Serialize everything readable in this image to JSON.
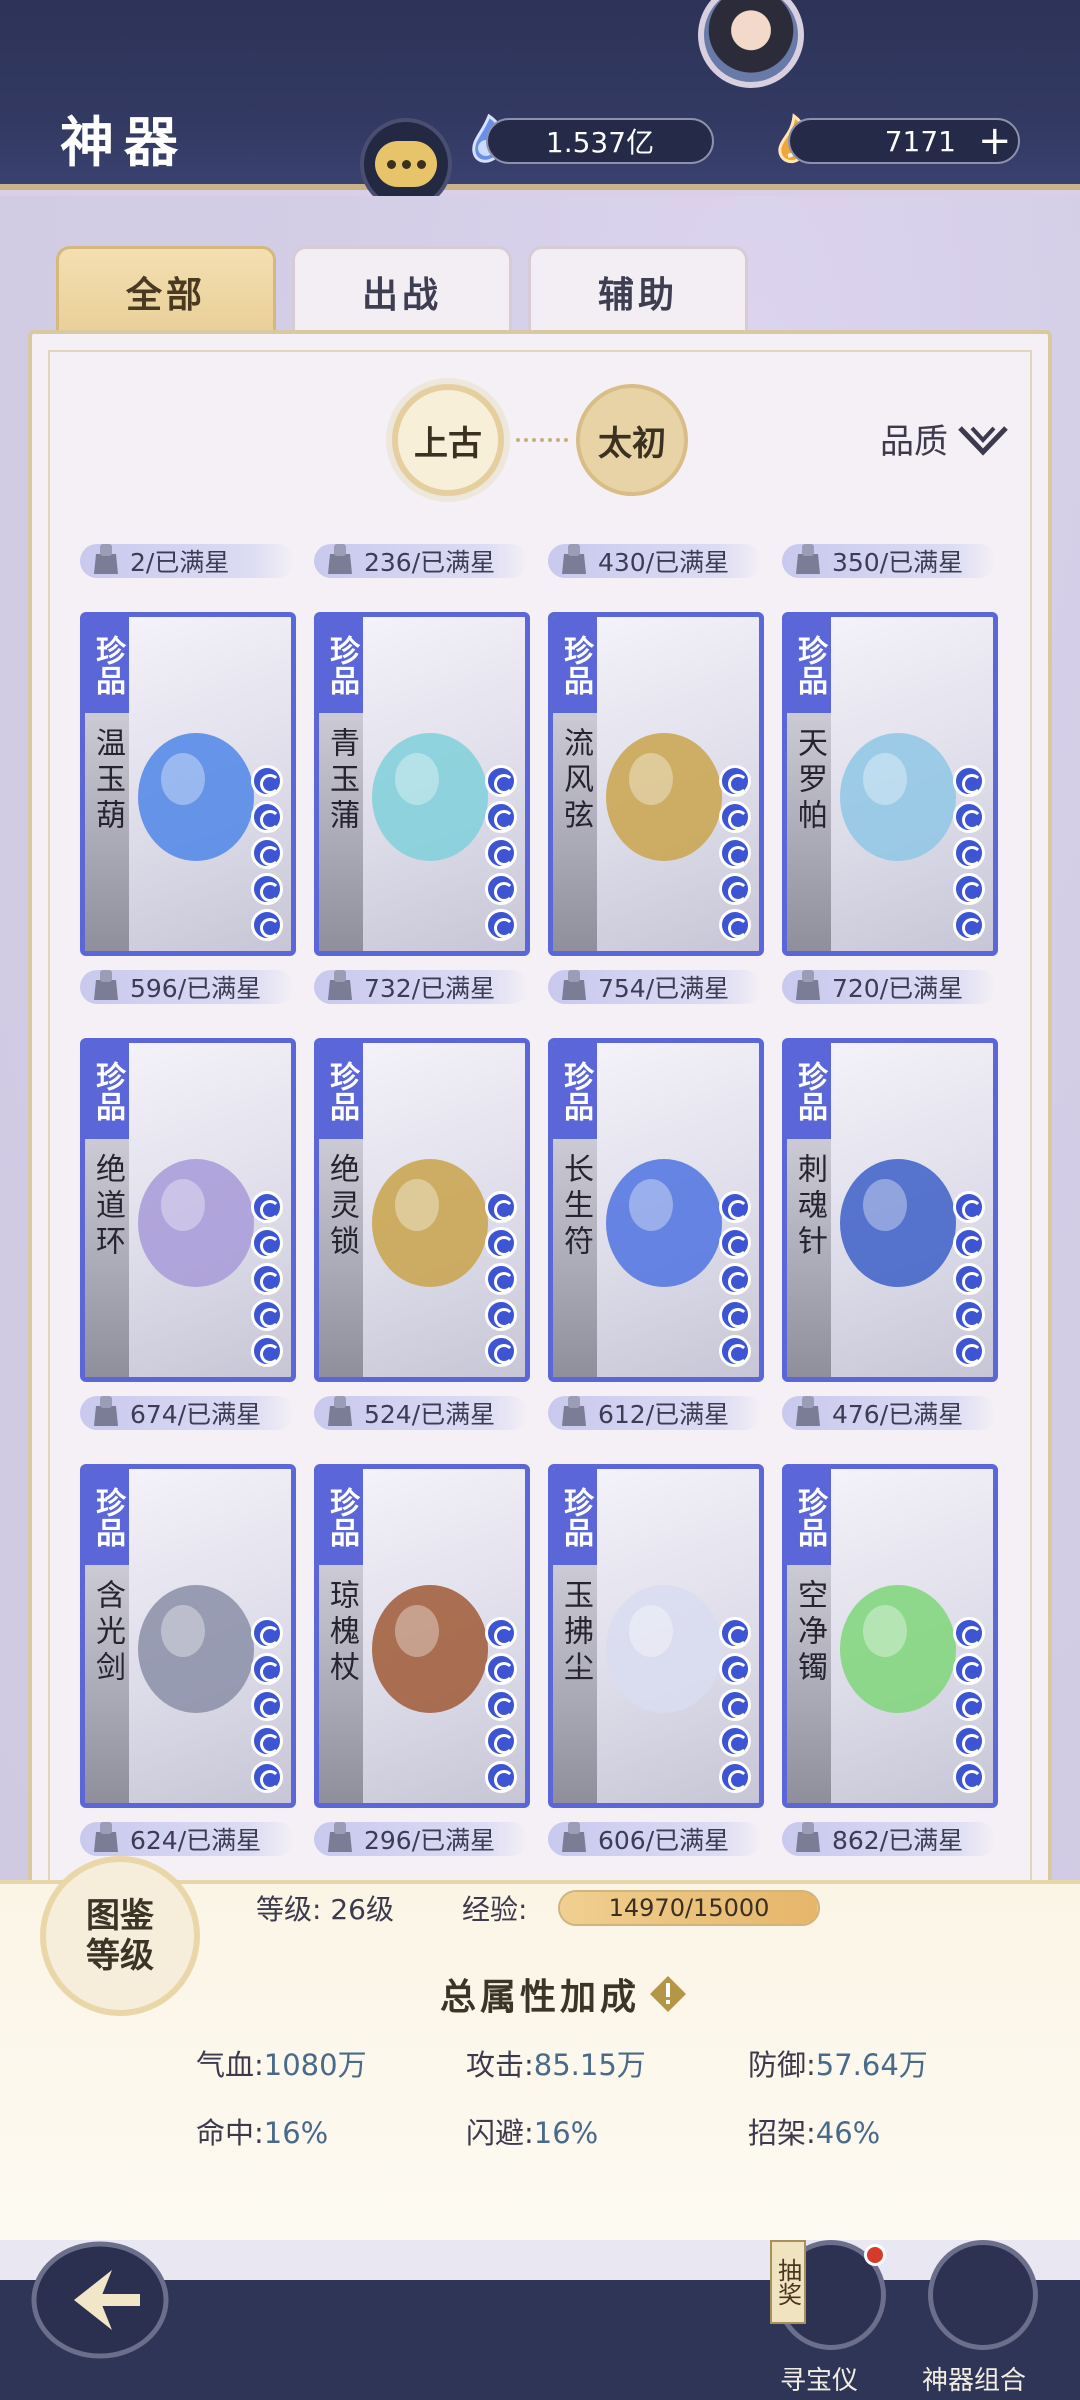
{
  "header": {
    "title": "神器",
    "jade_amount": "1.537亿",
    "gold_amount": "7171",
    "plus_label": "+"
  },
  "tabs": [
    {
      "label": "全部",
      "active": true
    },
    {
      "label": "出战",
      "active": false
    },
    {
      "label": "辅助",
      "active": false
    }
  ],
  "era": {
    "first": "上古",
    "second": "太初"
  },
  "filter": {
    "quality_label": "品质"
  },
  "top_counts": [
    "2/已满星",
    "236/已满星",
    "430/已满星",
    "350/已满星"
  ],
  "items": [
    {
      "rank": "珍品",
      "name": "温玉葫",
      "count": "596/已满星"
    },
    {
      "rank": "珍品",
      "name": "青玉蒲",
      "count": "732/已满星"
    },
    {
      "rank": "珍品",
      "name": "流风弦",
      "count": "754/已满星"
    },
    {
      "rank": "珍品",
      "name": "天罗帕",
      "count": "720/已满星"
    },
    {
      "rank": "珍品",
      "name": "绝道环",
      "count": "674/已满星"
    },
    {
      "rank": "珍品",
      "name": "绝灵锁",
      "count": "524/已满星"
    },
    {
      "rank": "珍品",
      "name": "长生符",
      "count": "612/已满星"
    },
    {
      "rank": "珍品",
      "name": "刺魂针",
      "count": "476/已满星"
    },
    {
      "rank": "珍品",
      "name": "含光剑",
      "count": "624/已满星"
    },
    {
      "rank": "珍品",
      "name": "琼槐杖",
      "count": "296/已满星"
    },
    {
      "rank": "珍品",
      "name": "玉拂尘",
      "count": "606/已满星"
    },
    {
      "rank": "珍品",
      "name": "空净镯",
      "count": "862/已满星"
    }
  ],
  "atlas": {
    "badge_label": "图鉴\n等级",
    "level_text": "等级: 26级",
    "exp_label": "经验:",
    "exp_text": "14970/15000",
    "exp_progress": 0.998
  },
  "total": {
    "title": "总属性加成",
    "stats": [
      {
        "label": "气血:",
        "value": "1080万"
      },
      {
        "label": "攻击:",
        "value": "85.15万"
      },
      {
        "label": "防御:",
        "value": "57.64万"
      },
      {
        "label": "命中:",
        "value": "16%"
      },
      {
        "label": "闪避:",
        "value": "16%"
      },
      {
        "label": "招架:",
        "value": "46%"
      }
    ]
  },
  "bottom_nav": {
    "lottery_tag": "抽奖",
    "lottery_label": "寻宝仪",
    "combo_label": "神器组合"
  },
  "colors": {
    "header_bg": "#2d3358",
    "rank_blue": "#5b67d8",
    "tab_active": "#f4dfb2"
  },
  "icons": [
    "chat-icon",
    "jade-currency-icon",
    "gold-currency-icon",
    "quality-filter-icon",
    "back-arrow-icon",
    "warning-icon",
    "star-orb-icon",
    "lock-pedestal-icon"
  ]
}
